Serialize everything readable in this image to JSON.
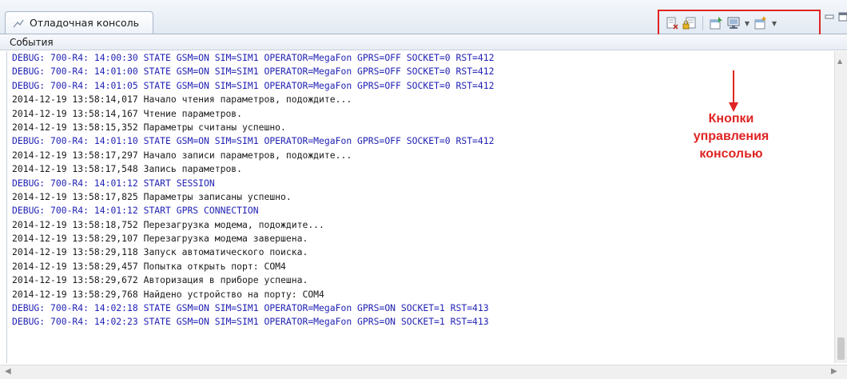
{
  "tab": {
    "title": "Отладочная консоль",
    "icon": "console-view-icon"
  },
  "toolbar": {
    "buttons": [
      {
        "icon": "clear-console-icon"
      },
      {
        "icon": "scroll-lock-icon"
      },
      {
        "icon": "pin-console-icon"
      },
      {
        "icon": "display-console-icon"
      },
      {
        "icon": "open-console-icon"
      }
    ]
  },
  "window_controls": [
    "minimize-icon",
    "maximize-icon"
  ],
  "events_header": "События",
  "log": [
    {
      "type": "debug",
      "text": "DEBUG: 700-R4: 14:00:30 STATE GSM=ON SIM=SIM1 OPERATOR=MegaFon GPRS=OFF SOCKET=0 RST=412"
    },
    {
      "type": "debug",
      "text": "DEBUG: 700-R4: 14:01:00 STATE GSM=ON SIM=SIM1 OPERATOR=MegaFon GPRS=OFF SOCKET=0 RST=412"
    },
    {
      "type": "debug",
      "text": "DEBUG: 700-R4: 14:01:05 STATE GSM=ON SIM=SIM1 OPERATOR=MegaFon GPRS=OFF SOCKET=0 RST=412"
    },
    {
      "type": "info",
      "text": "2014-12-19 13:58:14,017 Начало чтения параметров, подождите..."
    },
    {
      "type": "info",
      "text": "2014-12-19 13:58:14,167 Чтение параметров."
    },
    {
      "type": "info",
      "text": "2014-12-19 13:58:15,352 Параметры считаны успешно."
    },
    {
      "type": "debug",
      "text": "DEBUG: 700-R4: 14:01:10 STATE GSM=ON SIM=SIM1 OPERATOR=MegaFon GPRS=OFF SOCKET=0 RST=412"
    },
    {
      "type": "info",
      "text": "2014-12-19 13:58:17,297 Начало записи параметров, подождите..."
    },
    {
      "type": "info",
      "text": "2014-12-19 13:58:17,548 Запись параметров."
    },
    {
      "type": "debug",
      "text": "DEBUG: 700-R4: 14:01:12 START SESSION"
    },
    {
      "type": "info",
      "text": "2014-12-19 13:58:17,825 Параметры записаны успешно."
    },
    {
      "type": "debug",
      "text": "DEBUG: 700-R4: 14:01:12 START GPRS CONNECTION"
    },
    {
      "type": "info",
      "text": "2014-12-19 13:58:18,752 Перезагрузка модема, подождите..."
    },
    {
      "type": "info",
      "text": "2014-12-19 13:58:29,107 Перезагрузка модема завершена."
    },
    {
      "type": "info",
      "text": "2014-12-19 13:58:29,118 Запуск автоматического поиска."
    },
    {
      "type": "info",
      "text": "2014-12-19 13:58:29,457 Попытка открыть порт: COM4"
    },
    {
      "type": "info",
      "text": "2014-12-19 13:58:29,672 Авторизация в приборе успешна."
    },
    {
      "type": "info",
      "text": "2014-12-19 13:58:29,768 Найдено устройство на порту: COM4"
    },
    {
      "type": "debug",
      "text": "DEBUG: 700-R4: 14:02:18 STATE GSM=ON SIM=SIM1 OPERATOR=MegaFon GPRS=ON SOCKET=1 RST=413"
    },
    {
      "type": "debug",
      "text": "DEBUG: 700-R4: 14:02:23 STATE GSM=ON SIM=SIM1 OPERATOR=MegaFon GPRS=ON SOCKET=1 RST=413"
    }
  ],
  "annotation": {
    "lines": [
      "Кнопки",
      "управления",
      "консолью"
    ]
  },
  "colors": {
    "accent": "#e02424",
    "debug_text": "#1f1fb4",
    "info_text": "#1a1a1a"
  }
}
